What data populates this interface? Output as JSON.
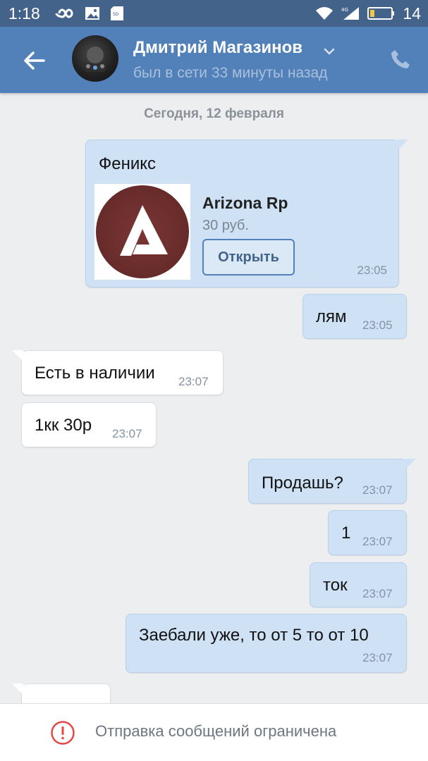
{
  "status_bar": {
    "time": "1:18",
    "battery": "14",
    "network": "4G",
    "icons": [
      "infinity-icon",
      "image-icon",
      "sd-card-icon",
      "wifi-icon",
      "signal-icon",
      "battery-icon"
    ]
  },
  "header": {
    "contact_name": "Дмитрий Магазинов",
    "status": "был в сети 33 минуты назад"
  },
  "date_separator": "Сегодня, 12 февраля",
  "product_message": {
    "caption": "Феникс",
    "product_title": "Arizona Rp",
    "product_price": "30 руб.",
    "open_button": "Открыть",
    "time": "23:05"
  },
  "messages": [
    {
      "text": "лям",
      "time": "23:05",
      "direction": "out"
    },
    {
      "text": "Есть в наличии",
      "time": "23:07",
      "direction": "in"
    },
    {
      "text": "1кк 30р",
      "time": "23:07",
      "direction": "in"
    },
    {
      "text": "Продашь?",
      "time": "23:07",
      "direction": "out"
    },
    {
      "text": "1",
      "time": "23:07",
      "direction": "out"
    },
    {
      "text": "ток",
      "time": "23:07",
      "direction": "out"
    },
    {
      "text": "Заебали уже, то от 5 то от 10",
      "time": "23:07",
      "direction": "out"
    }
  ],
  "footer": {
    "restricted_text": "Отправка сообщений ограничена"
  },
  "colors": {
    "header_bg": "#5181b8",
    "status_bar_bg": "#44638a",
    "outgoing_bubble": "#cfe1f5",
    "incoming_bubble": "#ffffff",
    "chat_bg": "#edeef0",
    "warning_red": "#e64646"
  }
}
